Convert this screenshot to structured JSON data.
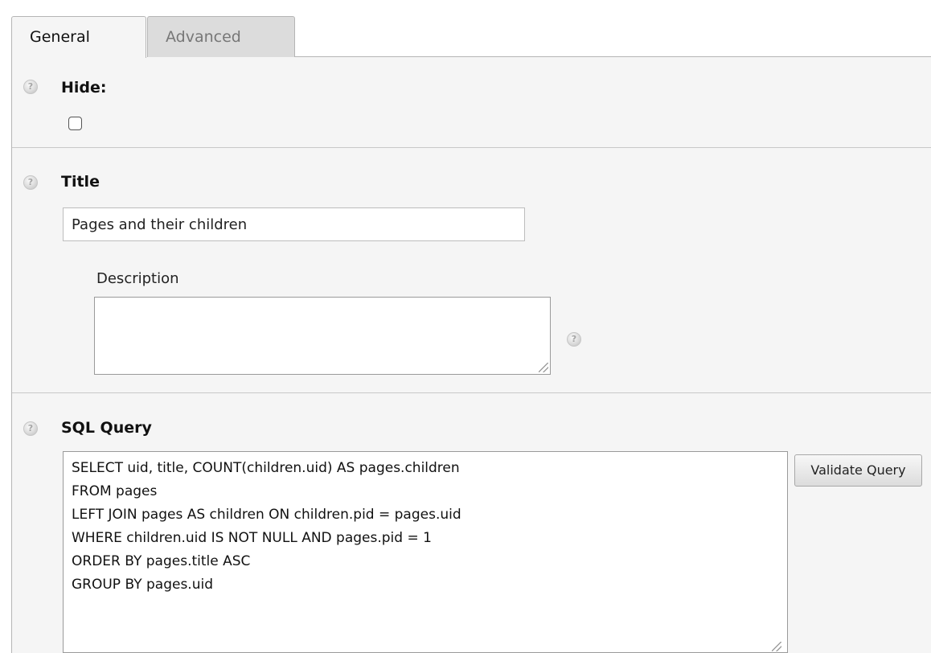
{
  "tabs": [
    {
      "label": "General"
    },
    {
      "label": "Advanced"
    }
  ],
  "fields": {
    "hide": {
      "label": "Hide:",
      "checked": false
    },
    "title": {
      "label": "Title",
      "value": "Pages and their children"
    },
    "description": {
      "label": "Description",
      "value": ""
    },
    "sql_query": {
      "label": "SQL Query",
      "value": "SELECT uid, title, COUNT(children.uid) AS pages.children\nFROM pages\nLEFT JOIN pages AS children ON children.pid = pages.uid\nWHERE children.uid IS NOT NULL AND pages.pid = 1\nORDER BY pages.title ASC\nGROUP BY pages.uid"
    }
  },
  "buttons": {
    "validate_query": "Validate Query"
  },
  "icons": {
    "help": "help-icon",
    "resize": "resize-grip-icon"
  }
}
